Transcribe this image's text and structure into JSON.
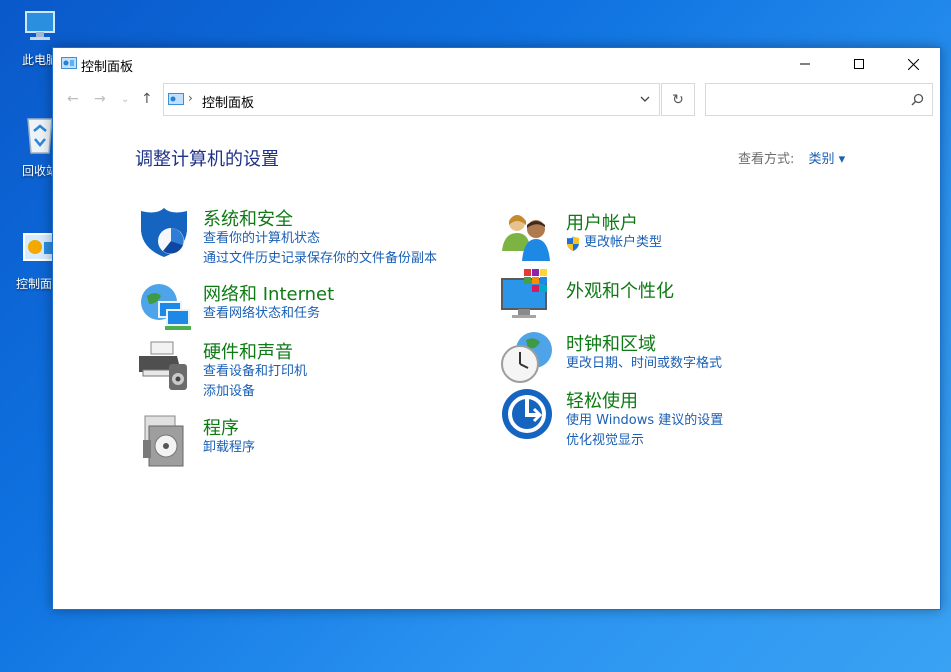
{
  "desktop": {
    "icons": [
      {
        "label": "此电脑"
      },
      {
        "label": "回收站"
      },
      {
        "label": "控制面板"
      }
    ]
  },
  "window": {
    "title": "控制面板",
    "breadcrumb": "控制面板",
    "search_placeholder": ""
  },
  "main": {
    "heading": "调整计算机的设置",
    "view_label": "查看方式:",
    "view_value": "类别 ▾",
    "categories": [
      {
        "title": "系统和安全",
        "links": [
          "查看你的计算机状态",
          "通过文件历史记录保存你的文件备份副本"
        ],
        "icon": "shield-icon"
      },
      {
        "title": "网络和 Internet",
        "links": [
          "查看网络状态和任务"
        ],
        "icon": "network-globe-icon"
      },
      {
        "title": "硬件和声音",
        "links": [
          "查看设备和打印机",
          "添加设备"
        ],
        "icon": "printer-speaker-icon"
      },
      {
        "title": "程序",
        "links": [
          "卸载程序"
        ],
        "icon": "programs-disc-icon"
      },
      {
        "title": "用户帐户",
        "links": [
          "更改帐户类型"
        ],
        "icon": "users-icon"
      },
      {
        "title": "外观和个性化",
        "links": [],
        "icon": "monitor-palette-icon"
      },
      {
        "title": "时钟和区域",
        "links": [
          "更改日期、时间或数字格式"
        ],
        "icon": "clock-globe-icon"
      },
      {
        "title": "轻松使用",
        "links": [
          "使用 Windows 建议的设置",
          "优化视觉显示"
        ],
        "icon": "ease-of-access-icon"
      }
    ]
  },
  "colors": {
    "heading": "#1e3287",
    "category_title": "#0e7a14",
    "link": "#1a5fb4",
    "desktop_bg": "#0f72e0"
  }
}
